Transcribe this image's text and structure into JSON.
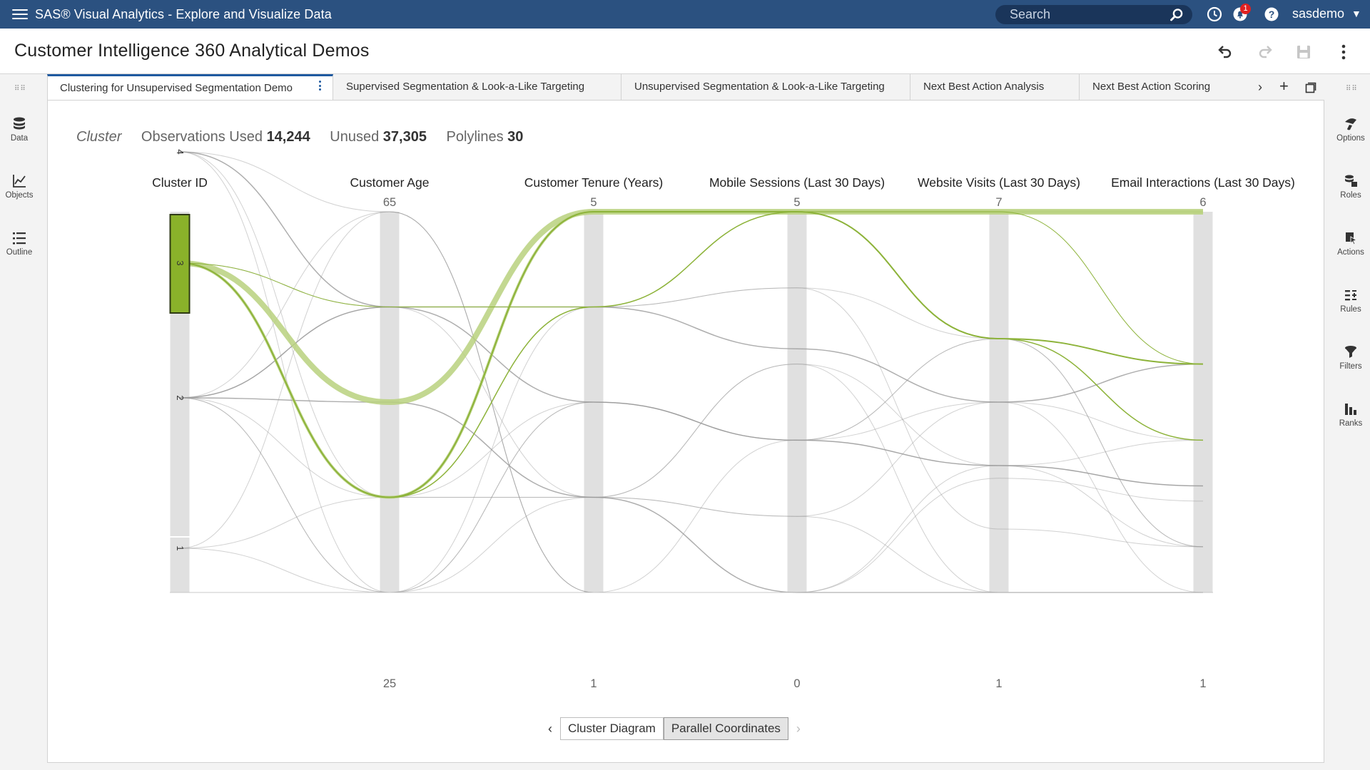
{
  "app": {
    "title": "SAS® Visual Analytics - Explore and Visualize Data",
    "search_placeholder": "Search",
    "notification_count": "1",
    "user": "sasdemo"
  },
  "report": {
    "title": "Customer Intelligence 360 Analytical Demos"
  },
  "left_rail": [
    {
      "label": "Data",
      "icon": "database-icon"
    },
    {
      "label": "Objects",
      "icon": "line-chart-icon"
    },
    {
      "label": "Outline",
      "icon": "list-icon"
    }
  ],
  "right_rail": [
    {
      "label": "Options",
      "icon": "paintbrush-icon"
    },
    {
      "label": "Roles",
      "icon": "roles-icon"
    },
    {
      "label": "Actions",
      "icon": "actions-icon"
    },
    {
      "label": "Rules",
      "icon": "rules-icon"
    },
    {
      "label": "Filters",
      "icon": "filter-icon"
    },
    {
      "label": "Ranks",
      "icon": "ranks-icon"
    }
  ],
  "tabs": [
    {
      "label": "Clustering for Unsupervised Segmentation Demo",
      "active": true
    },
    {
      "label": "Supervised Segmentation & Look-a-Like Targeting",
      "active": false
    },
    {
      "label": "Unsupervised Segmentation & Look-a-Like Targeting",
      "active": false
    },
    {
      "label": "Next Best Action Analysis",
      "active": false
    },
    {
      "label": "Next Best Action Scoring",
      "active": false
    }
  ],
  "summary": {
    "label": "Cluster",
    "observations_used_label": "Observations Used",
    "observations_used": "14,244",
    "unused_label": "Unused",
    "unused": "37,305",
    "polylines_label": "Polylines",
    "polylines": "30"
  },
  "chart_data": {
    "type": "parallel-coordinates",
    "axes": [
      {
        "name": "Cluster ID",
        "min": "",
        "max": "",
        "tick_labels": [
          "4",
          "3",
          "2",
          "1"
        ],
        "categories": [
          4,
          3,
          2,
          1
        ],
        "selected": 3
      },
      {
        "name": "Customer Age",
        "min": 25,
        "max": 65
      },
      {
        "name": "Customer Tenure (Years)",
        "min": 1,
        "max": 5
      },
      {
        "name": "Mobile Sessions (Last 30 Days)",
        "min": 0,
        "max": 5
      },
      {
        "name": "Website Visits (Last 30 Days)",
        "min": 1,
        "max": 7
      },
      {
        "name": "Email Interactions (Last 30 Days)",
        "min": 1,
        "max": 6
      }
    ],
    "colors": {
      "highlight": "#8db33a",
      "highlight_light": "#b9d17e",
      "line": "#9a9a9a",
      "axis": "#e0e0e0",
      "selected_box": "#8ab22a"
    },
    "polylines": [
      {
        "values": [
          3,
          45,
          5,
          5,
          7,
          6
        ],
        "weight": 8,
        "selected": true
      },
      {
        "values": [
          3,
          35,
          5,
          5,
          7,
          6
        ],
        "weight": 4,
        "selected": true
      },
      {
        "values": [
          3,
          35,
          5,
          5,
          5.0,
          4.0
        ],
        "weight": 2,
        "selected": true
      },
      {
        "values": [
          3,
          35,
          4,
          5,
          5.0,
          3.0
        ],
        "weight": 1.5,
        "selected": true
      },
      {
        "values": [
          3,
          55,
          4,
          5,
          7,
          4.0
        ],
        "weight": 1,
        "selected": true
      },
      {
        "values": [
          4,
          55,
          4,
          3.2,
          4.0,
          4.0
        ],
        "weight": 1.5,
        "selected": false
      },
      {
        "values": [
          4,
          35,
          2,
          1.0,
          1,
          1
        ],
        "weight": 1,
        "selected": false
      },
      {
        "values": [
          4,
          25,
          3,
          2.0,
          3.0,
          1.6
        ],
        "weight": 1,
        "selected": false
      },
      {
        "values": [
          2,
          55,
          3,
          2.0,
          3.0,
          2.4
        ],
        "weight": 1.5,
        "selected": false
      },
      {
        "values": [
          2,
          45,
          2,
          0,
          1,
          1
        ],
        "weight": 1.5,
        "selected": false
      },
      {
        "values": [
          2,
          65,
          1,
          0,
          2.8,
          2.2
        ],
        "weight": 1,
        "selected": false
      },
      {
        "values": [
          2,
          55,
          4,
          4.0,
          5.0,
          1.6
        ],
        "weight": 1,
        "selected": false
      },
      {
        "values": [
          2,
          25,
          3,
          2.0,
          4.0,
          3.0
        ],
        "weight": 1,
        "selected": false
      },
      {
        "values": [
          1,
          35,
          2,
          3.0,
          1,
          1
        ],
        "weight": 1,
        "selected": false
      },
      {
        "values": [
          1,
          25,
          4,
          4.0,
          2.0,
          1.6
        ],
        "weight": 1,
        "selected": false
      },
      {
        "values": [
          1,
          65,
          1,
          0,
          3.0,
          3.0
        ],
        "weight": 1,
        "selected": false
      },
      {
        "values": [
          4,
          65,
          1,
          2.0,
          5.0,
          4.0
        ],
        "weight": 1,
        "selected": false
      },
      {
        "values": [
          3,
          55,
          2,
          3.0,
          3.0,
          2.4
        ],
        "weight": 1,
        "selected": false
      },
      {
        "values": [
          2,
          35,
          3,
          2.0,
          5.0,
          1.6
        ],
        "weight": 1,
        "selected": false
      },
      {
        "values": [
          2,
          25,
          2,
          1.0,
          4.0,
          1
        ],
        "weight": 1,
        "selected": false
      }
    ]
  },
  "view_switcher": {
    "options": [
      "Cluster Diagram",
      "Parallel Coordinates"
    ],
    "selected": "Parallel Coordinates"
  }
}
